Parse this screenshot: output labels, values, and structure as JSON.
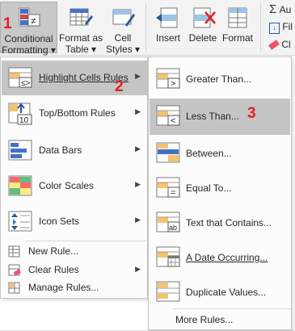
{
  "ribbon": {
    "conditional_formatting": {
      "line1": "Conditional",
      "line2": "Formatting ▾"
    },
    "format_as_table": {
      "line1": "Format as",
      "line2": "Table ▾"
    },
    "cell_styles": {
      "line1": "Cell",
      "line2": "Styles ▾"
    },
    "insert": "Insert",
    "delete": "Delete",
    "format": "Format",
    "autosum_partial": "Au",
    "fill_partial": "Fil",
    "clear_partial": "Cl"
  },
  "steps": {
    "one": "1",
    "two": "2",
    "three": "3"
  },
  "menu": {
    "highlight_cells_rules": "Highlight Cells Rules",
    "top_bottom_rules": "Top/Bottom Rules",
    "data_bars": "Data Bars",
    "color_scales": "Color Scales",
    "icon_sets": "Icon Sets",
    "new_rule": "New Rule...",
    "clear_rules": "Clear Rules",
    "manage_rules": "Manage Rules..."
  },
  "submenu": {
    "greater_than": "Greater Than...",
    "less_than": "Less Than...",
    "between": "Between...",
    "equal_to": "Equal To...",
    "text_that_contains": "Text that Contains...",
    "a_date_occurring": "A Date Occurring...",
    "duplicate_values": "Duplicate Values...",
    "more_rules": "More Rules..."
  },
  "colors": {
    "accent_red": "#e02020",
    "highlight": "#c5c5c5",
    "excel_blue": "#2b579a"
  }
}
